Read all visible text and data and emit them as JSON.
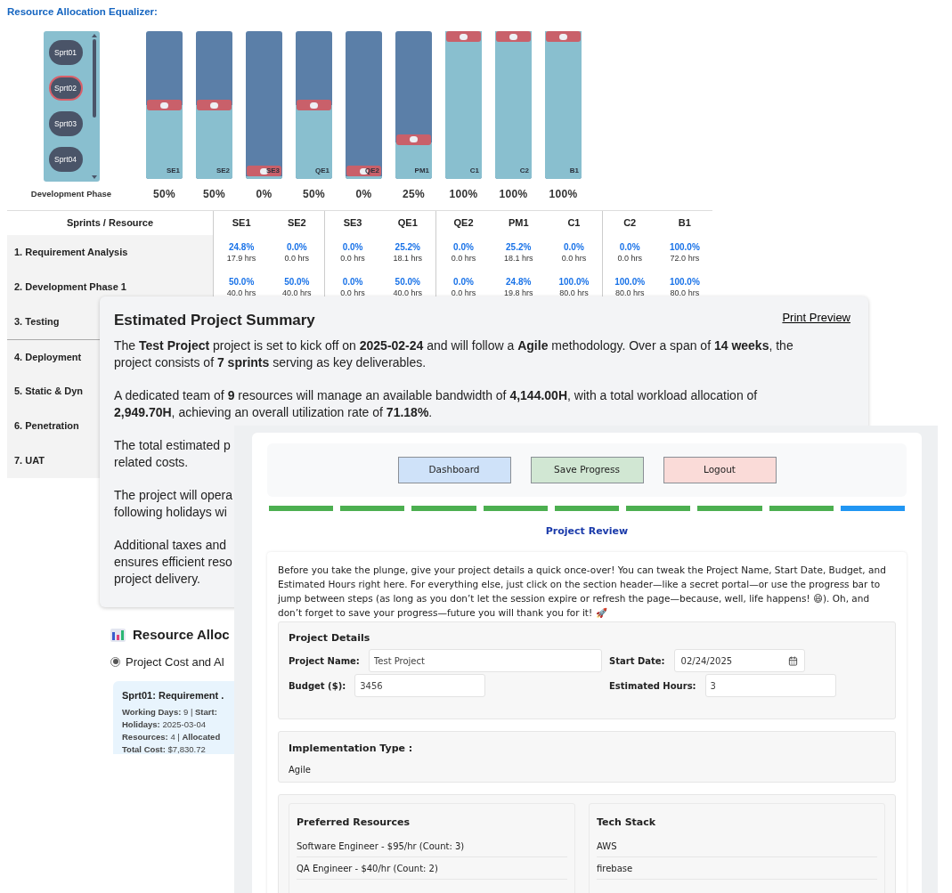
{
  "equalizer": {
    "title": "Resource Allocation Equalizer:",
    "phase_label": "Development Phase",
    "sprints": [
      {
        "label": "Sprt01",
        "selected": false
      },
      {
        "label": "Sprt02",
        "selected": true
      },
      {
        "label": "Sprt03",
        "selected": false
      },
      {
        "label": "Sprt04",
        "selected": false
      }
    ],
    "sliders": [
      {
        "label": "SE1",
        "level": 0.5,
        "reading": "50%"
      },
      {
        "label": "SE2",
        "level": 0.5,
        "reading": "50%"
      },
      {
        "label": "SE3",
        "level": 0,
        "reading": "0%"
      },
      {
        "label": "QE1",
        "level": 0.5,
        "reading": "50%"
      },
      {
        "label": "QE2",
        "level": 0,
        "reading": "0%"
      },
      {
        "label": "PM1",
        "level": 0.25,
        "reading": "25%"
      },
      {
        "label": "C1",
        "level": 1,
        "reading": "100%"
      },
      {
        "label": "C2",
        "level": 1,
        "reading": "100%"
      },
      {
        "label": "B1",
        "level": 1,
        "reading": "100%"
      }
    ]
  },
  "allocation_table": {
    "header": "Sprints / Resource",
    "columns": [
      "SE1",
      "SE2",
      "SE3",
      "QE1",
      "QE2",
      "PM1",
      "C1",
      "C2",
      "B1"
    ],
    "rows": [
      {
        "label": "1. Requirement Analysis",
        "cells": [
          {
            "pct": "24.8%",
            "hrs": "17.9 hrs"
          },
          {
            "pct": "0.0%",
            "hrs": "0.0 hrs"
          },
          {
            "pct": "0.0%",
            "hrs": "0.0 hrs"
          },
          {
            "pct": "25.2%",
            "hrs": "18.1 hrs"
          },
          {
            "pct": "0.0%",
            "hrs": "0.0 hrs"
          },
          {
            "pct": "25.2%",
            "hrs": "18.1 hrs"
          },
          {
            "pct": "0.0%",
            "hrs": "0.0 hrs"
          },
          {
            "pct": "0.0%",
            "hrs": "0.0 hrs"
          },
          {
            "pct": "100.0%",
            "hrs": "72.0 hrs"
          }
        ]
      },
      {
        "label": "2. Development Phase 1",
        "cells": [
          {
            "pct": "50.0%",
            "hrs": "40.0 hrs"
          },
          {
            "pct": "50.0%",
            "hrs": "40.0 hrs"
          },
          {
            "pct": "0.0%",
            "hrs": "0.0 hrs"
          },
          {
            "pct": "50.0%",
            "hrs": "40.0 hrs"
          },
          {
            "pct": "0.0%",
            "hrs": "0.0 hrs"
          },
          {
            "pct": "24.8%",
            "hrs": "19.8 hrs"
          },
          {
            "pct": "100.0%",
            "hrs": "80.0 hrs"
          },
          {
            "pct": "100.0%",
            "hrs": "80.0 hrs"
          },
          {
            "pct": "100.0%",
            "hrs": "80.0 hrs"
          }
        ]
      },
      {
        "label": "3. Testing"
      },
      {
        "label": "4. Deployment"
      },
      {
        "label": "5. Static & Dyn"
      },
      {
        "label": "6. Penetration"
      },
      {
        "label": "7. UAT"
      }
    ]
  },
  "summary": {
    "title": "Estimated Project Summary",
    "print_link": "Print Preview",
    "paragraphs": [
      [
        "The **Test Project** project is set to kick off on **2025-02-24** and will follow a **Agile** methodology. Over a span of **14 weeks**, the project consists of **7 sprints** serving as key deliverables."
      ],
      [
        "A dedicated team of **9** resources will manage an available bandwidth of **4,144.00H**, with a total workload allocation of **2,949.70H**, achieving an overall utilization rate of **71.18%**."
      ],
      [
        "The total estimated p",
        "related costs."
      ],
      [
        "The project will opera",
        "following holidays wi"
      ],
      [
        "Additional taxes and",
        "ensures efficient reso",
        "project delivery."
      ]
    ]
  },
  "resource_allocation": {
    "title": "Resource Alloc",
    "options": [
      {
        "label": "Project Cost and Al",
        "selected": true
      }
    ],
    "card": {
      "title": "Sprt01: Requirement .",
      "lines": [
        "**Working Days:** 9 | **Start:**",
        "**Holidays:** 2025-03-04",
        "**Resources:** 4 | **Allocated**",
        "**Total Cost:** $7,830.72"
      ]
    }
  },
  "review": {
    "buttons": [
      {
        "label": "Dashboard",
        "kind": "info"
      },
      {
        "label": "Save Progress",
        "kind": "success"
      },
      {
        "label": "Logout",
        "kind": "danger"
      }
    ],
    "steps": [
      {
        "current": false
      },
      {
        "current": false
      },
      {
        "current": false
      },
      {
        "current": false
      },
      {
        "current": false
      },
      {
        "current": false
      },
      {
        "current": false
      },
      {
        "current": false
      },
      {
        "current": true
      }
    ],
    "step_title": "Project Review",
    "intro": "Before you take the plunge, give your project details a quick once-over! You can tweak the Project Name, Start Date, Budget, and Estimated Hours right here. For everything else, just click on the section header—like a secret portal—or use the progress bar to jump between steps (as long as you don’t let the session expire or refresh the page—because, well, life happens! 😄). Oh, and don’t forget to save your progress—future you will thank you for it! 🚀",
    "details": {
      "title": "Project Details",
      "fields": [
        {
          "label": "Project Name:",
          "value": "Test Project",
          "kind": "text"
        },
        {
          "label": "Start Date:",
          "value": "02/24/2025",
          "kind": "date"
        },
        {
          "label": "Budget ($):",
          "value": "3456",
          "kind": "text"
        },
        {
          "label": "Estimated Hours:",
          "value": "3",
          "kind": "text"
        }
      ]
    },
    "implementation": {
      "title": "Implementation Type :",
      "value": "Agile"
    },
    "preferred_resources": {
      "title": "Preferred Resources",
      "items": [
        "Software Engineer - $95/hr (Count: 3)",
        "QA Engineer - $40/hr (Count: 2)"
      ]
    },
    "tech_stack": {
      "title": "Tech Stack",
      "items": [
        "AWS",
        "firebase"
      ]
    }
  }
}
